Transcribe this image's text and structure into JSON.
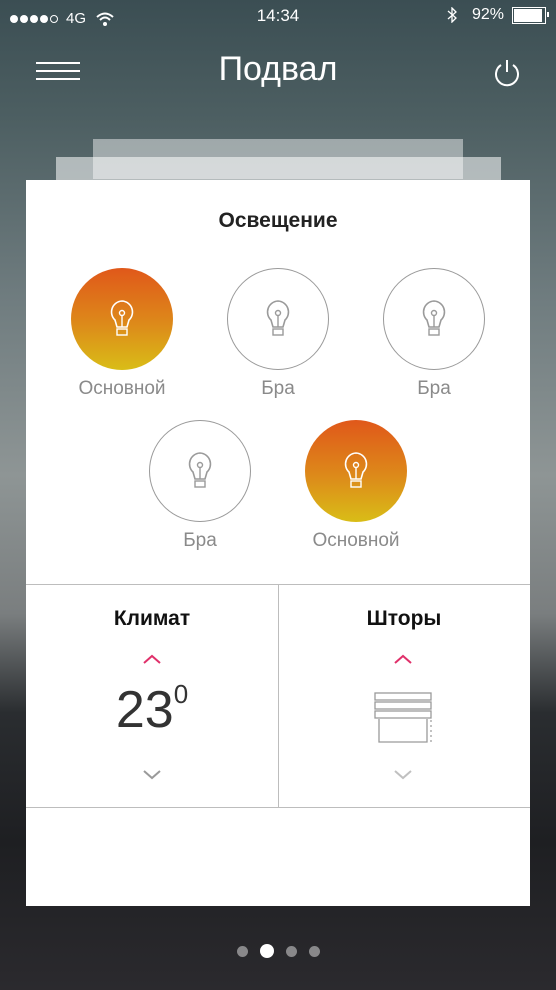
{
  "status_bar": {
    "carrier_network": "4G",
    "time": "14:34",
    "battery_percent": "92%",
    "signal_bars": 4
  },
  "header": {
    "title": "Подвал",
    "menu_icon": "menu-icon",
    "power_icon": "power-icon"
  },
  "lighting": {
    "title": "Освещение",
    "lamps": [
      {
        "label": "Основной",
        "on": true
      },
      {
        "label": "Бра",
        "on": false
      },
      {
        "label": "Бра",
        "on": false
      },
      {
        "label": "Бра",
        "on": false
      },
      {
        "label": "Основной",
        "on": true
      }
    ]
  },
  "climate": {
    "title": "Климат",
    "temperature": "23",
    "unit": "0"
  },
  "blinds": {
    "title": "Шторы"
  },
  "pager": {
    "pages": 4,
    "active": 1
  },
  "colors": {
    "accent_up": "#e0306a",
    "chevron_down": "#9a9a9a",
    "lamp_on_top": "#e0581a",
    "lamp_on_bottom": "#d9bd17"
  }
}
